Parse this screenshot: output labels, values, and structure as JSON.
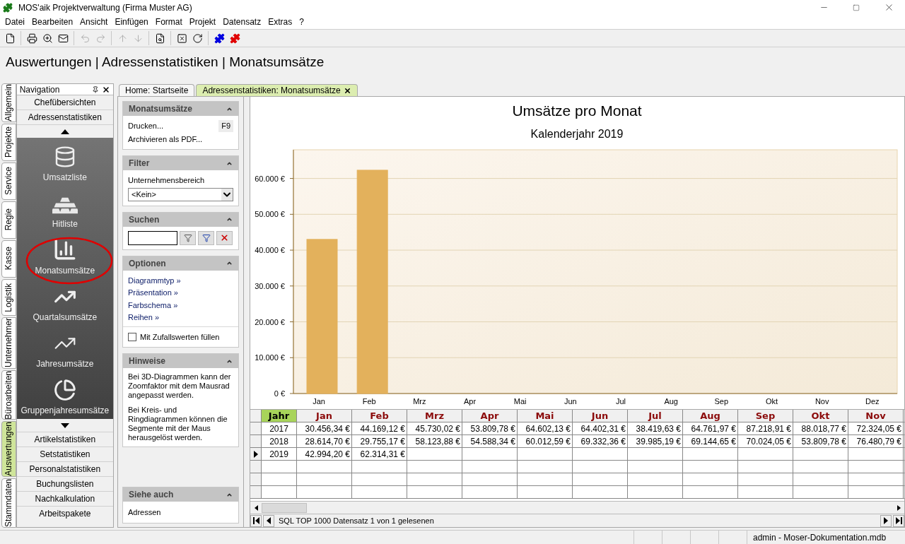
{
  "window": {
    "title": "MOS'aik Projektverwaltung (Firma Muster AG)"
  },
  "menu": [
    "Datei",
    "Bearbeiten",
    "Ansicht",
    "Einfügen",
    "Format",
    "Projekt",
    "Datensatz",
    "Extras",
    "?"
  ],
  "toolbar": [
    {
      "disabled": false
    },
    {
      "disabled": false
    },
    {
      "disabled": false
    },
    {
      "disabled": false
    },
    {
      "disabled": true
    },
    {
      "disabled": true
    },
    {
      "disabled": true
    },
    {
      "disabled": true
    },
    {
      "disabled": false
    },
    {
      "disabled": false
    },
    {
      "disabled": false
    },
    {
      "disabled": false
    },
    {
      "disabled": false
    }
  ],
  "heading": "Auswertungen | Adressenstatistiken | Monatsumsätze",
  "side_tabs": [
    {
      "label": "Allgemein",
      "selected": false
    },
    {
      "label": "Projekte",
      "selected": false
    },
    {
      "label": "Service",
      "selected": false
    },
    {
      "label": "Regie",
      "selected": false
    },
    {
      "label": "Kasse",
      "selected": false
    },
    {
      "label": "Logistik",
      "selected": false
    },
    {
      "label": "Unternehmer",
      "selected": false
    },
    {
      "label": "Büroarbeiten",
      "selected": false
    },
    {
      "label": "Auswertungen",
      "selected": true
    },
    {
      "label": "Stammdaten",
      "selected": false
    }
  ],
  "navigation": {
    "title": "Navigation",
    "groups_top": [
      "Chefübersichten",
      "Adressenstatistiken"
    ],
    "items": [
      {
        "label": "Umsatzliste",
        "selected": false
      },
      {
        "label": "Hitliste",
        "selected": false
      },
      {
        "label": "Monatsumsätze",
        "selected": true
      },
      {
        "label": "Quartalsumsätze",
        "selected": false
      },
      {
        "label": "Jahresumsätze",
        "selected": false
      },
      {
        "label": "Gruppenjahresumsätze",
        "selected": false
      }
    ],
    "groups_bottom": [
      "Artikelstatistiken",
      "Setstatistiken",
      "Personalstatistiken",
      "Buchungslisten",
      "Nachkalkulation",
      "Arbeitspakete"
    ]
  },
  "doc_tabs": [
    {
      "label": "Home: Startseite",
      "selected": false,
      "closable": false
    },
    {
      "label": "Adressenstatistiken: Monatsumsätze",
      "selected": true,
      "closable": true
    }
  ],
  "task_pane": {
    "monatsumsaetze": {
      "title": "Monatsumsätze",
      "actions": [
        {
          "label": "Drucken...",
          "shortcut": "F9"
        },
        {
          "label": "Archivieren als PDF..."
        }
      ]
    },
    "filter": {
      "title": "Filter",
      "label": "Unternehmensbereich",
      "value": "<Kein>"
    },
    "suchen": {
      "title": "Suchen"
    },
    "optionen": {
      "title": "Optionen",
      "links": [
        "Diagrammtyp »",
        "Präsentation »",
        "Farbschema »",
        "Reihen »"
      ],
      "checkbox": {
        "label": "Mit Zufallswerten füllen",
        "checked": false
      }
    },
    "hinweise": {
      "title": "Hinweise",
      "paragraphs": [
        "Bei 3D-Diagrammen kann der Zoomfaktor mit dem Mausrad angepasst werden.",
        "Bei Kreis- und Ringdiagrammen können die Segmente mit der Maus herausgelöst werden."
      ]
    },
    "siehe_auch": {
      "title": "Siehe auch",
      "links": [
        "Adressen"
      ]
    }
  },
  "chart": {
    "subtitle": "Kalenderjahr 2019",
    "chart_data": {
      "type": "bar",
      "title": "Umsätze pro Monat",
      "categories": [
        "Jan",
        "Feb",
        "Mrz",
        "Apr",
        "Mai",
        "Jun",
        "Jul",
        "Aug",
        "Sep",
        "Okt",
        "Nov",
        "Dez"
      ],
      "series": [
        {
          "color": "#e3b15c",
          "values": [
            43000,
            62300,
            null,
            null,
            null,
            null,
            null,
            null,
            null,
            null,
            null,
            null
          ]
        }
      ],
      "ylim": [
        0,
        68000
      ],
      "grid": true,
      "yticks": [
        {
          "value": 0,
          "label": "0 €"
        },
        {
          "value": 10000,
          "label": "10.000 €"
        },
        {
          "value": 20000,
          "label": "20.000 €"
        },
        {
          "value": 30000,
          "label": "30.000 €"
        },
        {
          "value": 40000,
          "label": "40.000 €"
        },
        {
          "value": 50000,
          "label": "50.000 €"
        },
        {
          "value": 60000,
          "label": "60.000 €"
        }
      ]
    }
  },
  "table": {
    "columns": [
      "Jahr",
      "Jan",
      "Feb",
      "Mrz",
      "Apr",
      "Mai",
      "Jun",
      "Jul",
      "Aug",
      "Sep",
      "Okt",
      "Nov"
    ],
    "rows": [
      {
        "selected": false,
        "cells": [
          "2017",
          "30.456,34 €",
          "44.169,12 €",
          "45.730,02 €",
          "53.809,78 €",
          "64.602,13 €",
          "64.402,31 €",
          "38.419,63 €",
          "64.761,97 €",
          "87.218,91 €",
          "88.018,77 €",
          "72.324,05 €"
        ]
      },
      {
        "selected": false,
        "cells": [
          "2018",
          "28.614,70 €",
          "29.755,17 €",
          "58.123,88 €",
          "54.588,34 €",
          "60.012,59 €",
          "69.332,36 €",
          "39.985,19 €",
          "69.144,65 €",
          "70.024,05 €",
          "53.809,78 €",
          "76.480,79 €"
        ]
      },
      {
        "selected": true,
        "cells": [
          "2019",
          "42.994,20 €",
          "62.314,31 €"
        ]
      }
    ],
    "navigator": "SQL TOP 1000 Datensatz 1 von 1 gelesenen"
  },
  "status_bar": {
    "text": "admin - Moser-Dokumentation.mdb"
  }
}
